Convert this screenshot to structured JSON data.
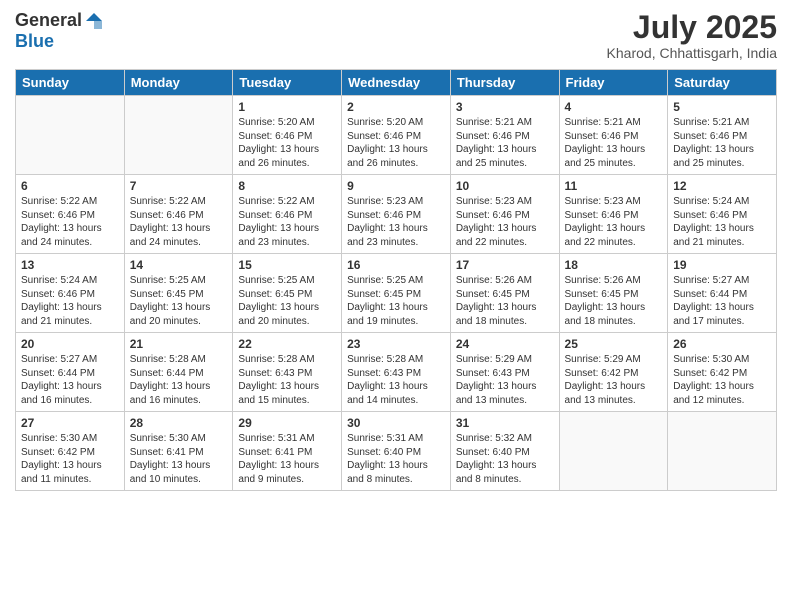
{
  "header": {
    "logo_general": "General",
    "logo_blue": "Blue",
    "month_title": "July 2025",
    "subtitle": "Kharod, Chhattisgarh, India"
  },
  "calendar": {
    "days_of_week": [
      "Sunday",
      "Monday",
      "Tuesday",
      "Wednesday",
      "Thursday",
      "Friday",
      "Saturday"
    ],
    "weeks": [
      [
        {
          "day": "",
          "info": ""
        },
        {
          "day": "",
          "info": ""
        },
        {
          "day": "1",
          "info": "Sunrise: 5:20 AM\nSunset: 6:46 PM\nDaylight: 13 hours and 26 minutes."
        },
        {
          "day": "2",
          "info": "Sunrise: 5:20 AM\nSunset: 6:46 PM\nDaylight: 13 hours and 26 minutes."
        },
        {
          "day": "3",
          "info": "Sunrise: 5:21 AM\nSunset: 6:46 PM\nDaylight: 13 hours and 25 minutes."
        },
        {
          "day": "4",
          "info": "Sunrise: 5:21 AM\nSunset: 6:46 PM\nDaylight: 13 hours and 25 minutes."
        },
        {
          "day": "5",
          "info": "Sunrise: 5:21 AM\nSunset: 6:46 PM\nDaylight: 13 hours and 25 minutes."
        }
      ],
      [
        {
          "day": "6",
          "info": "Sunrise: 5:22 AM\nSunset: 6:46 PM\nDaylight: 13 hours and 24 minutes."
        },
        {
          "day": "7",
          "info": "Sunrise: 5:22 AM\nSunset: 6:46 PM\nDaylight: 13 hours and 24 minutes."
        },
        {
          "day": "8",
          "info": "Sunrise: 5:22 AM\nSunset: 6:46 PM\nDaylight: 13 hours and 23 minutes."
        },
        {
          "day": "9",
          "info": "Sunrise: 5:23 AM\nSunset: 6:46 PM\nDaylight: 13 hours and 23 minutes."
        },
        {
          "day": "10",
          "info": "Sunrise: 5:23 AM\nSunset: 6:46 PM\nDaylight: 13 hours and 22 minutes."
        },
        {
          "day": "11",
          "info": "Sunrise: 5:23 AM\nSunset: 6:46 PM\nDaylight: 13 hours and 22 minutes."
        },
        {
          "day": "12",
          "info": "Sunrise: 5:24 AM\nSunset: 6:46 PM\nDaylight: 13 hours and 21 minutes."
        }
      ],
      [
        {
          "day": "13",
          "info": "Sunrise: 5:24 AM\nSunset: 6:46 PM\nDaylight: 13 hours and 21 minutes."
        },
        {
          "day": "14",
          "info": "Sunrise: 5:25 AM\nSunset: 6:45 PM\nDaylight: 13 hours and 20 minutes."
        },
        {
          "day": "15",
          "info": "Sunrise: 5:25 AM\nSunset: 6:45 PM\nDaylight: 13 hours and 20 minutes."
        },
        {
          "day": "16",
          "info": "Sunrise: 5:25 AM\nSunset: 6:45 PM\nDaylight: 13 hours and 19 minutes."
        },
        {
          "day": "17",
          "info": "Sunrise: 5:26 AM\nSunset: 6:45 PM\nDaylight: 13 hours and 18 minutes."
        },
        {
          "day": "18",
          "info": "Sunrise: 5:26 AM\nSunset: 6:45 PM\nDaylight: 13 hours and 18 minutes."
        },
        {
          "day": "19",
          "info": "Sunrise: 5:27 AM\nSunset: 6:44 PM\nDaylight: 13 hours and 17 minutes."
        }
      ],
      [
        {
          "day": "20",
          "info": "Sunrise: 5:27 AM\nSunset: 6:44 PM\nDaylight: 13 hours and 16 minutes."
        },
        {
          "day": "21",
          "info": "Sunrise: 5:28 AM\nSunset: 6:44 PM\nDaylight: 13 hours and 16 minutes."
        },
        {
          "day": "22",
          "info": "Sunrise: 5:28 AM\nSunset: 6:43 PM\nDaylight: 13 hours and 15 minutes."
        },
        {
          "day": "23",
          "info": "Sunrise: 5:28 AM\nSunset: 6:43 PM\nDaylight: 13 hours and 14 minutes."
        },
        {
          "day": "24",
          "info": "Sunrise: 5:29 AM\nSunset: 6:43 PM\nDaylight: 13 hours and 13 minutes."
        },
        {
          "day": "25",
          "info": "Sunrise: 5:29 AM\nSunset: 6:42 PM\nDaylight: 13 hours and 13 minutes."
        },
        {
          "day": "26",
          "info": "Sunrise: 5:30 AM\nSunset: 6:42 PM\nDaylight: 13 hours and 12 minutes."
        }
      ],
      [
        {
          "day": "27",
          "info": "Sunrise: 5:30 AM\nSunset: 6:42 PM\nDaylight: 13 hours and 11 minutes."
        },
        {
          "day": "28",
          "info": "Sunrise: 5:30 AM\nSunset: 6:41 PM\nDaylight: 13 hours and 10 minutes."
        },
        {
          "day": "29",
          "info": "Sunrise: 5:31 AM\nSunset: 6:41 PM\nDaylight: 13 hours and 9 minutes."
        },
        {
          "day": "30",
          "info": "Sunrise: 5:31 AM\nSunset: 6:40 PM\nDaylight: 13 hours and 8 minutes."
        },
        {
          "day": "31",
          "info": "Sunrise: 5:32 AM\nSunset: 6:40 PM\nDaylight: 13 hours and 8 minutes."
        },
        {
          "day": "",
          "info": ""
        },
        {
          "day": "",
          "info": ""
        }
      ]
    ]
  }
}
